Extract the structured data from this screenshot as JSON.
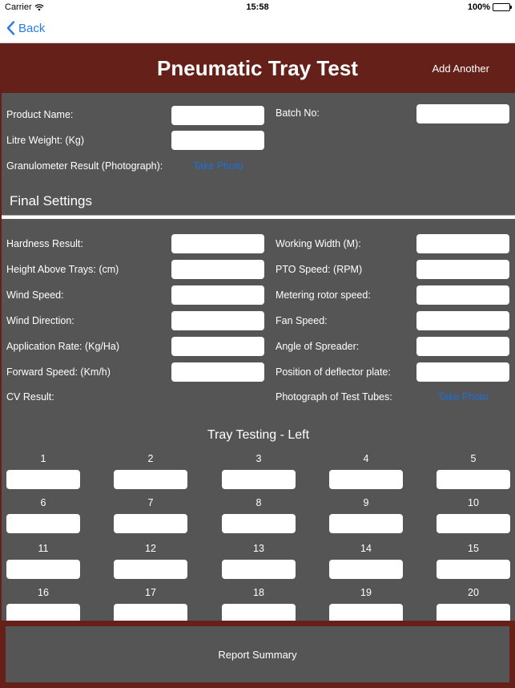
{
  "status_bar": {
    "carrier": "Carrier",
    "time": "15:58",
    "battery": "100%",
    "wifi_icon": "wifi-icon",
    "battery_icon": "battery-icon"
  },
  "nav": {
    "back_label": "Back",
    "back_icon": "chevron-left-icon"
  },
  "header": {
    "title": "Pneumatic Tray Test",
    "add_another": "Add Another"
  },
  "product": {
    "product_name": {
      "label": "Product Name:",
      "value": ""
    },
    "batch_no": {
      "label": "Batch No:",
      "value": ""
    },
    "litre_weight": {
      "label": "Litre Weight: (Kg)",
      "value": ""
    },
    "granulometer": {
      "label": "Granulometer Result (Photograph):",
      "action": "Take Photo"
    }
  },
  "final_settings": {
    "title": "Final Settings",
    "left": [
      {
        "label": "Hardness Result:",
        "value": ""
      },
      {
        "label": "Height Above Trays: (cm)",
        "value": ""
      },
      {
        "label": "Wind Speed:",
        "value": ""
      },
      {
        "label": "Wind Direction:",
        "value": ""
      },
      {
        "label": "Application Rate: (Kg/Ha)",
        "value": ""
      },
      {
        "label": "Forward Speed: (Km/h)",
        "value": ""
      }
    ],
    "right": [
      {
        "label": "Working Width (M):",
        "value": ""
      },
      {
        "label": "PTO Speed: (RPM)",
        "value": ""
      },
      {
        "label": "Metering rotor speed:",
        "value": ""
      },
      {
        "label": "Fan Speed:",
        "value": ""
      },
      {
        "label": "Angle of Spreader:",
        "value": ""
      },
      {
        "label": "Position of deflector plate:",
        "value": ""
      }
    ],
    "cv_result": {
      "label": "CV Result:"
    },
    "test_tubes": {
      "label": "Photograph of Test Tubes:",
      "action": "Take Photo"
    }
  },
  "tray_testing": {
    "title": "Tray Testing - Left",
    "trays": [
      "1",
      "2",
      "3",
      "4",
      "5",
      "6",
      "7",
      "8",
      "9",
      "10",
      "11",
      "12",
      "13",
      "14",
      "15",
      "16",
      "17",
      "18",
      "19",
      "20"
    ]
  },
  "footer": {
    "report_summary": "Report Summary"
  }
}
